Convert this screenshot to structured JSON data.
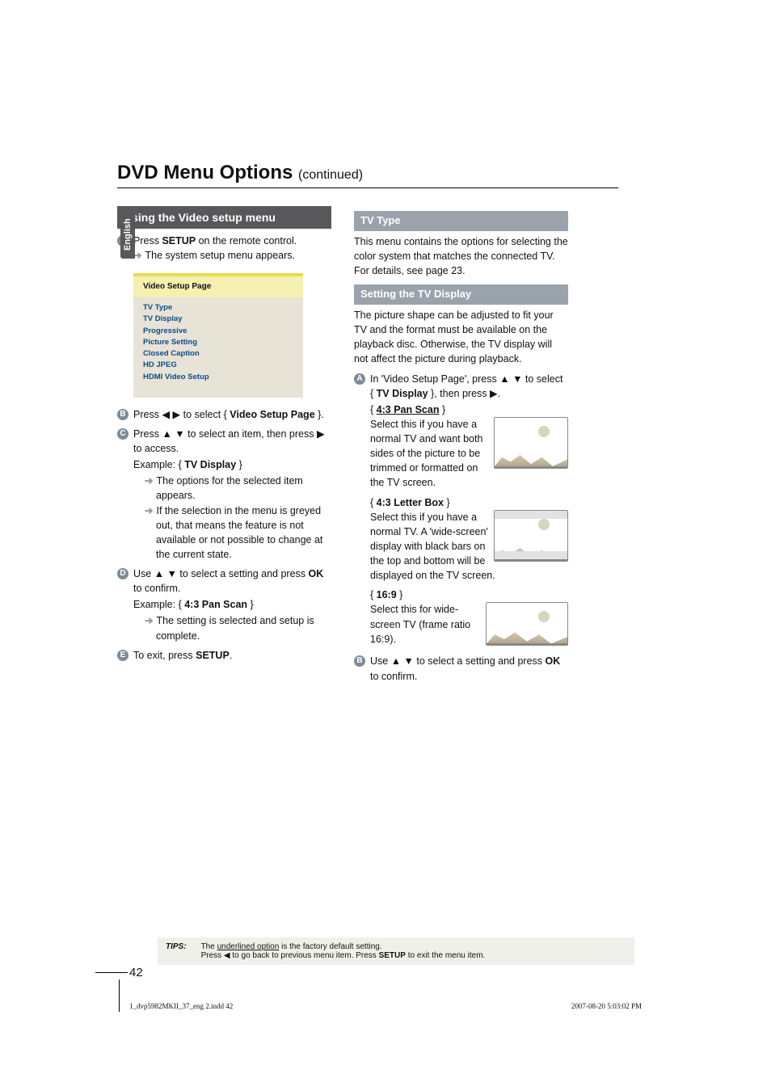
{
  "lang_tab": "English",
  "title_main": "DVD Menu Options ",
  "title_cont": "(continued)",
  "left": {
    "section_title": "Using the Video setup menu",
    "step1_pre": "Press ",
    "step1_b": "SETUP",
    "step1_post": " on the remote control.",
    "step1_res": "The system setup menu appears.",
    "osd_title": "Video Setup Page",
    "osd_items": [
      "TV Type",
      "TV Display",
      "Progressive",
      "Picture Setting",
      "Closed Caption",
      "HD JPEG",
      "HDMI Video Setup"
    ],
    "step2_pre": "Press ",
    "step2_arrows": "◀ ▶",
    "step2_mid": " to select { ",
    "step2_b": "Video Setup Page",
    "step2_post": " }.",
    "step3_pre": "Press ",
    "step3_arrows": "▲ ▼",
    "step3_mid": " to select an item, then press ",
    "step3_arrow2": "▶",
    "step3_post": " to access.",
    "step3_ex_pre": "Example: { ",
    "step3_ex_b": "TV Display",
    "step3_ex_post": " }",
    "step3_res1": "The options for the selected item appears.",
    "step3_res2": "If the selection in the menu is greyed out, that means the feature is not available or not possible to change at the current state.",
    "step4_pre": "Use ",
    "step4_arrows": "▲ ▼",
    "step4_mid": " to select a setting and press ",
    "step4_b": "OK",
    "step4_post": " to confirm.",
    "step4_ex_pre": "Example: { ",
    "step4_ex_b": "4:3 Pan Scan",
    "step4_ex_post": " }",
    "step4_res": "The setting is selected and setup is complete.",
    "step5_pre": "To exit, press ",
    "step5_b": "SETUP",
    "step5_post": "."
  },
  "right": {
    "sub1_title": "TV Type",
    "sub1_body": "This menu contains the options for selecting the color system that matches the connected TV.  For details, see page 23.",
    "sub2_title": "Setting the TV Display",
    "sub2_body": "The picture shape can be adjusted to fit your TV and the format must be available on the playback disc. Otherwise, the TV display will not affect the picture during playback.",
    "r_step1_pre": "In 'Video Setup Page', press ",
    "r_step1_arrows": "▲ ▼",
    "r_step1_mid": " to select { ",
    "r_step1_b": "TV Display",
    "r_step1_post": " }, then press ",
    "r_step1_arrow2": "▶",
    "r_step1_end": ".",
    "opt1_title": "4:3 Pan Scan",
    "opt1_body": "Select this if you have a normal TV and want both sides of the picture to be trimmed or formatted on the TV screen.",
    "opt2_title": "4:3 Letter Box",
    "opt2_body": "Select this if you have a normal TV.  A  'wide-screen' display with black bars on the top and bottom will be displayed on the TV screen.",
    "opt3_title": "16:9",
    "opt3_body": "Select this for wide-screen TV (frame ratio 16:9).",
    "r_step2_pre": "Use ",
    "r_step2_arrows": "▲ ▼",
    "r_step2_mid": " to select a setting and press ",
    "r_step2_b": "OK",
    "r_step2_post": " to confirm."
  },
  "tips_label": "TIPS:",
  "tips_line1_pre": "The ",
  "tips_line1_u": "underlined option",
  "tips_line1_post": " is the factory default setting.",
  "tips_line2_pre": "Press ",
  "tips_line2_arrow": "◀",
  "tips_line2_mid": " to go back to previous menu item. Press ",
  "tips_line2_b": "SETUP",
  "tips_line2_post": " to exit the menu item.",
  "page_num": "42",
  "footer_left": "1_dvp5982MKII_37_eng 2.indd   42",
  "footer_right": "2007-08-20   5:03:02 PM"
}
